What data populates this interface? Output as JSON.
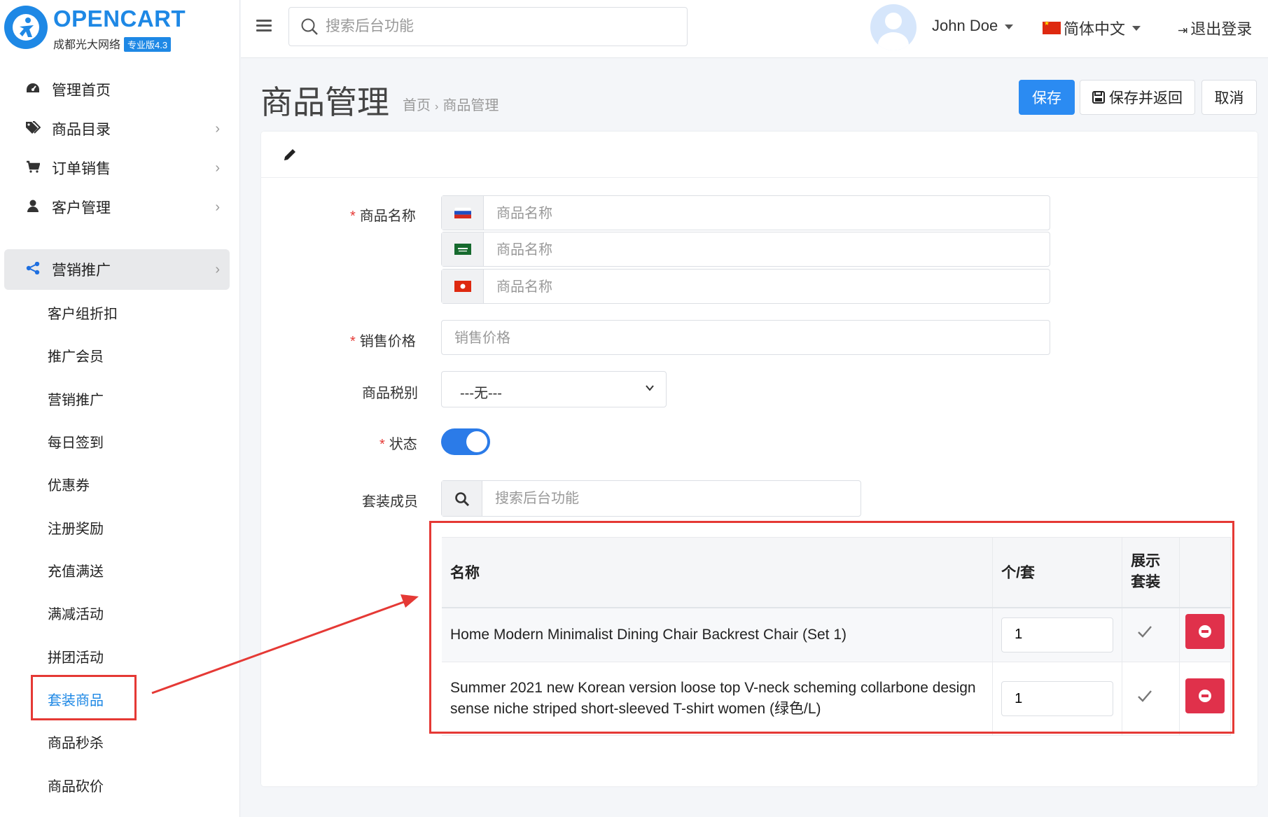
{
  "brand": {
    "title": "OPENCART",
    "subtitle": "成都光大网络",
    "badge": "专业版4.3"
  },
  "sidebar": {
    "items": [
      {
        "label": "管理首页",
        "icon": "dashboard-icon"
      },
      {
        "label": "商品目录",
        "icon": "tags-icon"
      },
      {
        "label": "订单销售",
        "icon": "cart-icon"
      },
      {
        "label": "客户管理",
        "icon": "user-icon"
      },
      {
        "label": "营销推广",
        "icon": "share-icon"
      }
    ],
    "subitems": [
      "客户组折扣",
      "推广会员",
      "营销推广",
      "每日签到",
      "优惠券",
      "注册奖励",
      "充值满送",
      "满减活动",
      "拼团活动",
      "套装商品",
      "商品秒杀",
      "商品砍价"
    ]
  },
  "topbar": {
    "search_placeholder": "搜索后台功能",
    "user_name": "John Doe",
    "language": "简体中文",
    "logout": "退出登录"
  },
  "header": {
    "title": "商品管理",
    "breadcrumb_home": "首页",
    "breadcrumb_current": "商品管理",
    "save": "保存",
    "save_back": "保存并返回",
    "cancel": "取消"
  },
  "form": {
    "name_label": "商品名称",
    "name_placeholder": "商品名称",
    "price_label": "销售价格",
    "price_placeholder": "销售价格",
    "tax_label": "商品税别",
    "tax_value": "---无---",
    "status_label": "状态",
    "status_on": true,
    "suite_label": "套装成员",
    "suite_placeholder": "搜索后台功能"
  },
  "table": {
    "headers": {
      "name": "名称",
      "qty": "个/套",
      "show_line1": "展示",
      "show_line2": "套装"
    },
    "rows": [
      {
        "name": "Home Modern Minimalist Dining Chair Backrest Chair (Set 1)",
        "qty": "1",
        "show": true
      },
      {
        "name": "Summer 2021 new Korean version loose top V-neck scheming collarbone design sense niche striped short-sleeved T-shirt women (绿色/L)",
        "qty": "1",
        "show": true
      }
    ]
  },
  "colors": {
    "primary": "#2b8bf2",
    "danger": "#e0314b",
    "annotation": "#e53935"
  }
}
